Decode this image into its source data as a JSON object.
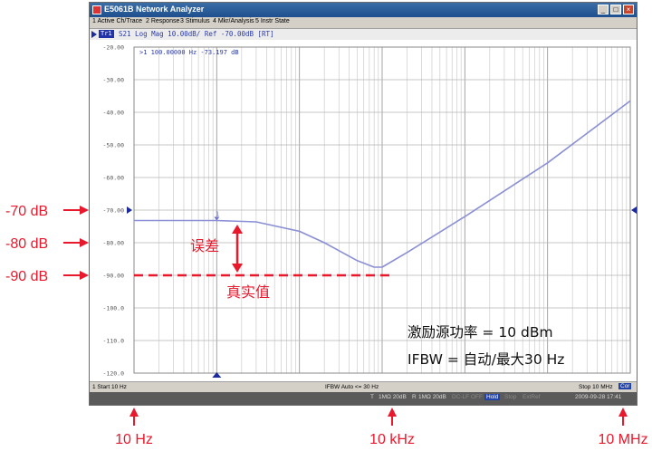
{
  "window": {
    "title": "E5061B Network Analyzer",
    "menu": [
      "1 Active Ch/Trace",
      "2 Response",
      "3 Stimulus",
      "4 Mkr/Analysis",
      "5 Instr State"
    ],
    "trace_tag": "Tr1",
    "trace_info": "S21  Log Mag 10.00dB/ Ref -70.00dB [RT]",
    "controls": {
      "minimize": "_",
      "maximize": "□",
      "close": "×"
    }
  },
  "chart_data": {
    "type": "line",
    "x_scale": "log",
    "xlim_hz": [
      10,
      10000000
    ],
    "ylim_db": [
      -120,
      -20
    ],
    "y_ticks": [
      "-20.00",
      "-30.00",
      "-40.00",
      "-50.00",
      "-60.00",
      "-70.00",
      "-80.00",
      "-90.00",
      "-100.0",
      "-110.0",
      "-120.0"
    ],
    "grid": true,
    "marker_readout": ">1  100.00000 Hz -73.197 dB",
    "marker_label": "1",
    "series": [
      {
        "color": "#8a8fd6",
        "x": [
          10,
          100,
          300,
          1000,
          2000,
          5000,
          8000,
          10000,
          20000,
          100000,
          1000000,
          10000000
        ],
        "y": [
          -73.2,
          -73.2,
          -73.6,
          -76.5,
          -80,
          -85.5,
          -87.5,
          -87.5,
          -83,
          -72,
          -55.5,
          -36.5
        ]
      }
    ]
  },
  "status": {
    "start": "1  Start 10 Hz",
    "ifbw": "IFBW Auto <= 30 Hz",
    "stop": "Stop 10 MHz",
    "stop_badge": "Cor",
    "bottom": [
      "T",
      "1MΩ 20dB",
      "R",
      "1MΩ 20dB",
      "DC-LF OFF",
      "Hold",
      "Stop",
      "ExtRef",
      "2009-09-28 17:41"
    ]
  },
  "annotations": {
    "ref_labels": [
      "-70 dB",
      "-80 dB",
      "-90 dB"
    ],
    "error_label": "误差",
    "true_value_label": "真实值",
    "excitation_power": "激励源功率 = 10 dBm",
    "ifbw_note": "IFBW = 自动/最大30 Hz",
    "x_labels": [
      "10 Hz",
      "10 kHz",
      "10 MHz"
    ],
    "red": "#e8192c"
  }
}
